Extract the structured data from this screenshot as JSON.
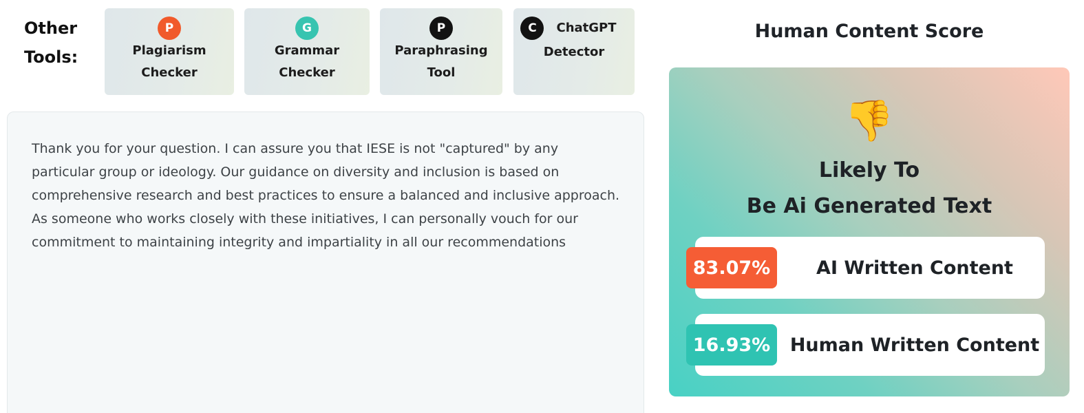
{
  "other_tools": {
    "label_line1": "Other",
    "label_line2": "Tools:",
    "tools": [
      {
        "badge": "P",
        "line1": "Plagiarism",
        "line2": "Checker",
        "badge_color": "#f15a2b"
      },
      {
        "badge": "G",
        "line1": "Grammar",
        "line2": "Checker",
        "badge_color": "#37c4b0"
      },
      {
        "badge": "P",
        "line1": "Paraphrasing",
        "line2": "Tool",
        "badge_color": "#121212"
      },
      {
        "badge": "C",
        "line1": "ChatGPT",
        "line2": "Detector",
        "badge_color": "#121212"
      }
    ]
  },
  "input_text": "Thank you for your question. I can assure you that IESE is not \"captured\" by any particular group or ideology. Our guidance on diversity and inclusion is based on comprehensive research and best practices to ensure a balanced and inclusive approach. As someone who works closely with these initiatives, I can personally vouch for our commitment to maintaining integrity and impartiality in all our recommendations",
  "score": {
    "title": "Human Content Score",
    "icon": "thumbs-down-icon",
    "verdict_line1": "Likely To",
    "verdict_line2": "Be Ai Generated Text",
    "ai": {
      "percent": "83.07%",
      "label": "AI Written Content",
      "color": "#f55d35"
    },
    "human": {
      "percent": "16.93%",
      "label": "Human Written Content",
      "color": "#2fc3b2"
    }
  }
}
